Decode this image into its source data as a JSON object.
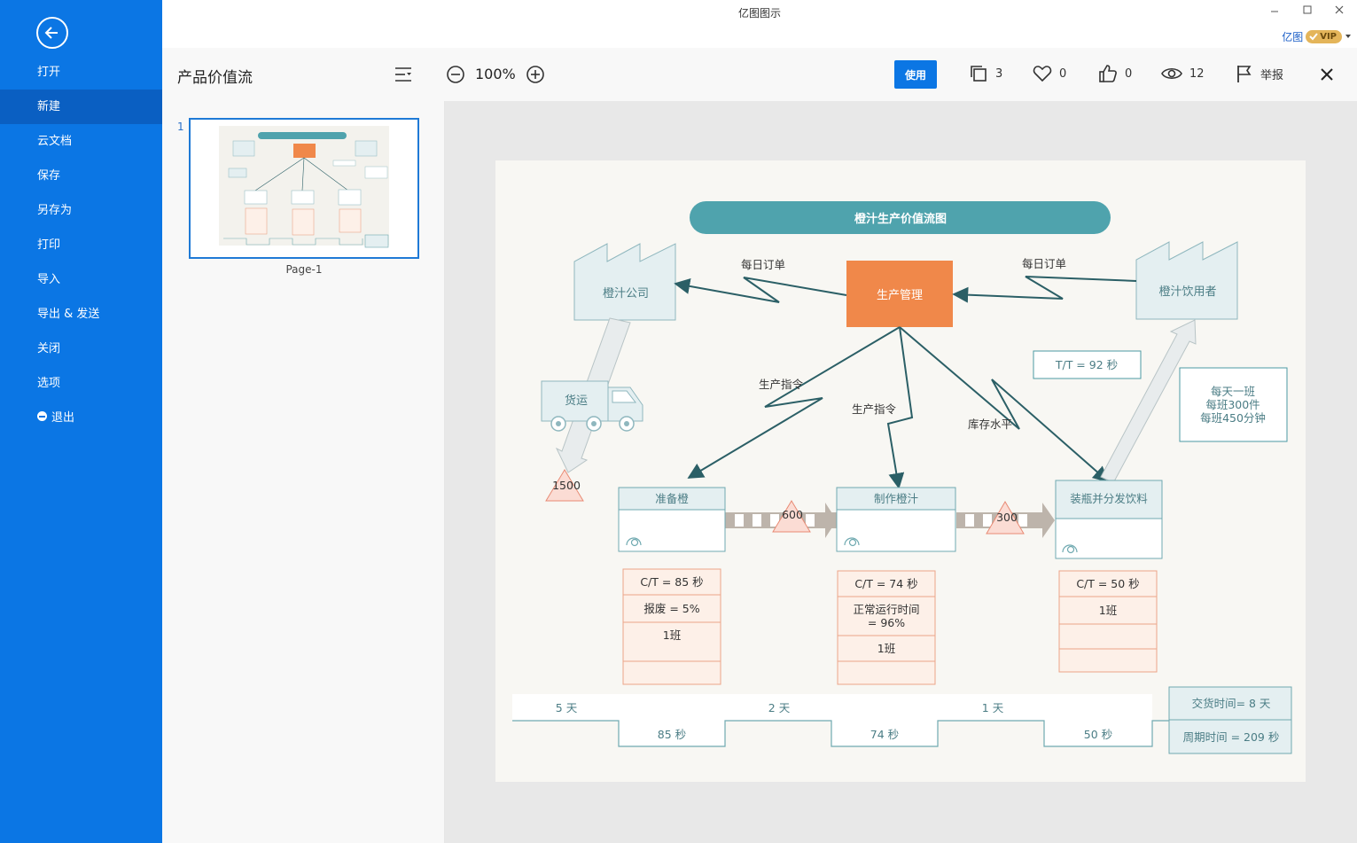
{
  "app": {
    "title": "亿图图示",
    "brand": "亿图",
    "vip": "VIP"
  },
  "sidebar": {
    "items": [
      {
        "label": "打开"
      },
      {
        "label": "新建"
      },
      {
        "label": "云文档"
      },
      {
        "label": "保存"
      },
      {
        "label": "另存为"
      },
      {
        "label": "打印"
      },
      {
        "label": "导入"
      },
      {
        "label": "导出 & 发送"
      },
      {
        "label": "关闭"
      },
      {
        "label": "选项"
      },
      {
        "label": "退出"
      }
    ]
  },
  "toolbar": {
    "doc_title": "产品价值流",
    "zoom": "100%",
    "use_label": "使用",
    "copies": "3",
    "likes": "0",
    "thumbs": "0",
    "views": "12",
    "report_label": "举报"
  },
  "pages": {
    "number": "1",
    "label": "Page-1"
  },
  "diagram": {
    "title": "橙汁生产价值流图",
    "supplier": "橙汁公司",
    "customer": "橙汁饮用者",
    "control": "生产管理",
    "daily_order_left": "每日订单",
    "daily_order_right": "每日订单",
    "command_1": "生产指令",
    "command_2": "生产指令",
    "inventory_level": "库存水平",
    "truck": "货运",
    "takt": "T/T = 92 秒",
    "demand": [
      "每天一班",
      "每班300件",
      "每班450分钟"
    ],
    "inv_1500": "1500",
    "inv_600": "600",
    "inv_300": "300",
    "process_1": "准备橙",
    "process_2": "制作橙汁",
    "process_3": "装瓶并分发饮料",
    "data_1": {
      "ct": "C/T = 85 秒",
      "scrap": "报废 = 5%",
      "shift": "1班"
    },
    "data_2": {
      "ct": "C/T = 74 秒",
      "uptime_1": "正常运行时间",
      "uptime_2": "= 96%",
      "shift": "1班"
    },
    "data_3": {
      "ct": "C/T = 50 秒",
      "shift": "1班"
    },
    "timeline": {
      "days": [
        "5 天",
        "2 天",
        "1 天"
      ],
      "seconds": [
        "85 秒",
        "74 秒",
        "50 秒"
      ],
      "lead_time": "交货时间= 8 天",
      "cycle_time": "周期时间 = 209 秒"
    }
  },
  "colors": {
    "sidebar": "#0b76e4",
    "sidebar_active": "#0a5fc2",
    "title_bar": "#4fa3ad",
    "control_box": "#f0884a",
    "arrow": "#2b5f66",
    "factory_fill": "#e4eff1",
    "factory_stroke": "#8fb7be",
    "data_fill": "#fdf0e8",
    "data_stroke": "#eba589"
  }
}
